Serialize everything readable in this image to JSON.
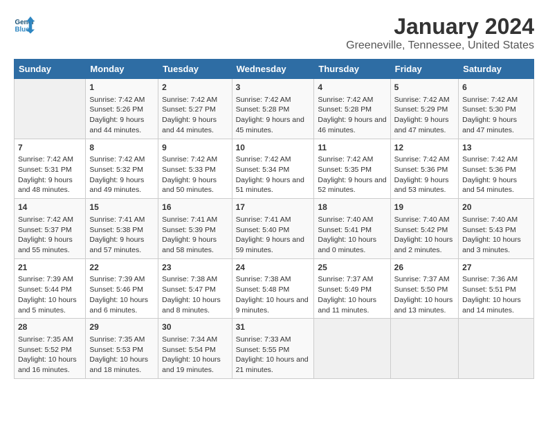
{
  "logo": {
    "text_general": "General",
    "text_blue": "Blue"
  },
  "title": "January 2024",
  "subtitle": "Greeneville, Tennessee, United States",
  "days_of_week": [
    "Sunday",
    "Monday",
    "Tuesday",
    "Wednesday",
    "Thursday",
    "Friday",
    "Saturday"
  ],
  "weeks": [
    [
      {
        "day": "",
        "sunrise": "",
        "sunset": "",
        "daylight": "",
        "empty": true
      },
      {
        "day": "1",
        "sunrise": "Sunrise: 7:42 AM",
        "sunset": "Sunset: 5:26 PM",
        "daylight": "Daylight: 9 hours and 44 minutes."
      },
      {
        "day": "2",
        "sunrise": "Sunrise: 7:42 AM",
        "sunset": "Sunset: 5:27 PM",
        "daylight": "Daylight: 9 hours and 44 minutes."
      },
      {
        "day": "3",
        "sunrise": "Sunrise: 7:42 AM",
        "sunset": "Sunset: 5:28 PM",
        "daylight": "Daylight: 9 hours and 45 minutes."
      },
      {
        "day": "4",
        "sunrise": "Sunrise: 7:42 AM",
        "sunset": "Sunset: 5:28 PM",
        "daylight": "Daylight: 9 hours and 46 minutes."
      },
      {
        "day": "5",
        "sunrise": "Sunrise: 7:42 AM",
        "sunset": "Sunset: 5:29 PM",
        "daylight": "Daylight: 9 hours and 47 minutes."
      },
      {
        "day": "6",
        "sunrise": "Sunrise: 7:42 AM",
        "sunset": "Sunset: 5:30 PM",
        "daylight": "Daylight: 9 hours and 47 minutes."
      }
    ],
    [
      {
        "day": "7",
        "sunrise": "Sunrise: 7:42 AM",
        "sunset": "Sunset: 5:31 PM",
        "daylight": "Daylight: 9 hours and 48 minutes."
      },
      {
        "day": "8",
        "sunrise": "Sunrise: 7:42 AM",
        "sunset": "Sunset: 5:32 PM",
        "daylight": "Daylight: 9 hours and 49 minutes."
      },
      {
        "day": "9",
        "sunrise": "Sunrise: 7:42 AM",
        "sunset": "Sunset: 5:33 PM",
        "daylight": "Daylight: 9 hours and 50 minutes."
      },
      {
        "day": "10",
        "sunrise": "Sunrise: 7:42 AM",
        "sunset": "Sunset: 5:34 PM",
        "daylight": "Daylight: 9 hours and 51 minutes."
      },
      {
        "day": "11",
        "sunrise": "Sunrise: 7:42 AM",
        "sunset": "Sunset: 5:35 PM",
        "daylight": "Daylight: 9 hours and 52 minutes."
      },
      {
        "day": "12",
        "sunrise": "Sunrise: 7:42 AM",
        "sunset": "Sunset: 5:36 PM",
        "daylight": "Daylight: 9 hours and 53 minutes."
      },
      {
        "day": "13",
        "sunrise": "Sunrise: 7:42 AM",
        "sunset": "Sunset: 5:36 PM",
        "daylight": "Daylight: 9 hours and 54 minutes."
      }
    ],
    [
      {
        "day": "14",
        "sunrise": "Sunrise: 7:42 AM",
        "sunset": "Sunset: 5:37 PM",
        "daylight": "Daylight: 9 hours and 55 minutes."
      },
      {
        "day": "15",
        "sunrise": "Sunrise: 7:41 AM",
        "sunset": "Sunset: 5:38 PM",
        "daylight": "Daylight: 9 hours and 57 minutes."
      },
      {
        "day": "16",
        "sunrise": "Sunrise: 7:41 AM",
        "sunset": "Sunset: 5:39 PM",
        "daylight": "Daylight: 9 hours and 58 minutes."
      },
      {
        "day": "17",
        "sunrise": "Sunrise: 7:41 AM",
        "sunset": "Sunset: 5:40 PM",
        "daylight": "Daylight: 9 hours and 59 minutes."
      },
      {
        "day": "18",
        "sunrise": "Sunrise: 7:40 AM",
        "sunset": "Sunset: 5:41 PM",
        "daylight": "Daylight: 10 hours and 0 minutes."
      },
      {
        "day": "19",
        "sunrise": "Sunrise: 7:40 AM",
        "sunset": "Sunset: 5:42 PM",
        "daylight": "Daylight: 10 hours and 2 minutes."
      },
      {
        "day": "20",
        "sunrise": "Sunrise: 7:40 AM",
        "sunset": "Sunset: 5:43 PM",
        "daylight": "Daylight: 10 hours and 3 minutes."
      }
    ],
    [
      {
        "day": "21",
        "sunrise": "Sunrise: 7:39 AM",
        "sunset": "Sunset: 5:44 PM",
        "daylight": "Daylight: 10 hours and 5 minutes."
      },
      {
        "day": "22",
        "sunrise": "Sunrise: 7:39 AM",
        "sunset": "Sunset: 5:46 PM",
        "daylight": "Daylight: 10 hours and 6 minutes."
      },
      {
        "day": "23",
        "sunrise": "Sunrise: 7:38 AM",
        "sunset": "Sunset: 5:47 PM",
        "daylight": "Daylight: 10 hours and 8 minutes."
      },
      {
        "day": "24",
        "sunrise": "Sunrise: 7:38 AM",
        "sunset": "Sunset: 5:48 PM",
        "daylight": "Daylight: 10 hours and 9 minutes."
      },
      {
        "day": "25",
        "sunrise": "Sunrise: 7:37 AM",
        "sunset": "Sunset: 5:49 PM",
        "daylight": "Daylight: 10 hours and 11 minutes."
      },
      {
        "day": "26",
        "sunrise": "Sunrise: 7:37 AM",
        "sunset": "Sunset: 5:50 PM",
        "daylight": "Daylight: 10 hours and 13 minutes."
      },
      {
        "day": "27",
        "sunrise": "Sunrise: 7:36 AM",
        "sunset": "Sunset: 5:51 PM",
        "daylight": "Daylight: 10 hours and 14 minutes."
      }
    ],
    [
      {
        "day": "28",
        "sunrise": "Sunrise: 7:35 AM",
        "sunset": "Sunset: 5:52 PM",
        "daylight": "Daylight: 10 hours and 16 minutes."
      },
      {
        "day": "29",
        "sunrise": "Sunrise: 7:35 AM",
        "sunset": "Sunset: 5:53 PM",
        "daylight": "Daylight: 10 hours and 18 minutes."
      },
      {
        "day": "30",
        "sunrise": "Sunrise: 7:34 AM",
        "sunset": "Sunset: 5:54 PM",
        "daylight": "Daylight: 10 hours and 19 minutes."
      },
      {
        "day": "31",
        "sunrise": "Sunrise: 7:33 AM",
        "sunset": "Sunset: 5:55 PM",
        "daylight": "Daylight: 10 hours and 21 minutes."
      },
      {
        "day": "",
        "sunrise": "",
        "sunset": "",
        "daylight": "",
        "empty": true
      },
      {
        "day": "",
        "sunrise": "",
        "sunset": "",
        "daylight": "",
        "empty": true
      },
      {
        "day": "",
        "sunrise": "",
        "sunset": "",
        "daylight": "",
        "empty": true
      }
    ]
  ]
}
